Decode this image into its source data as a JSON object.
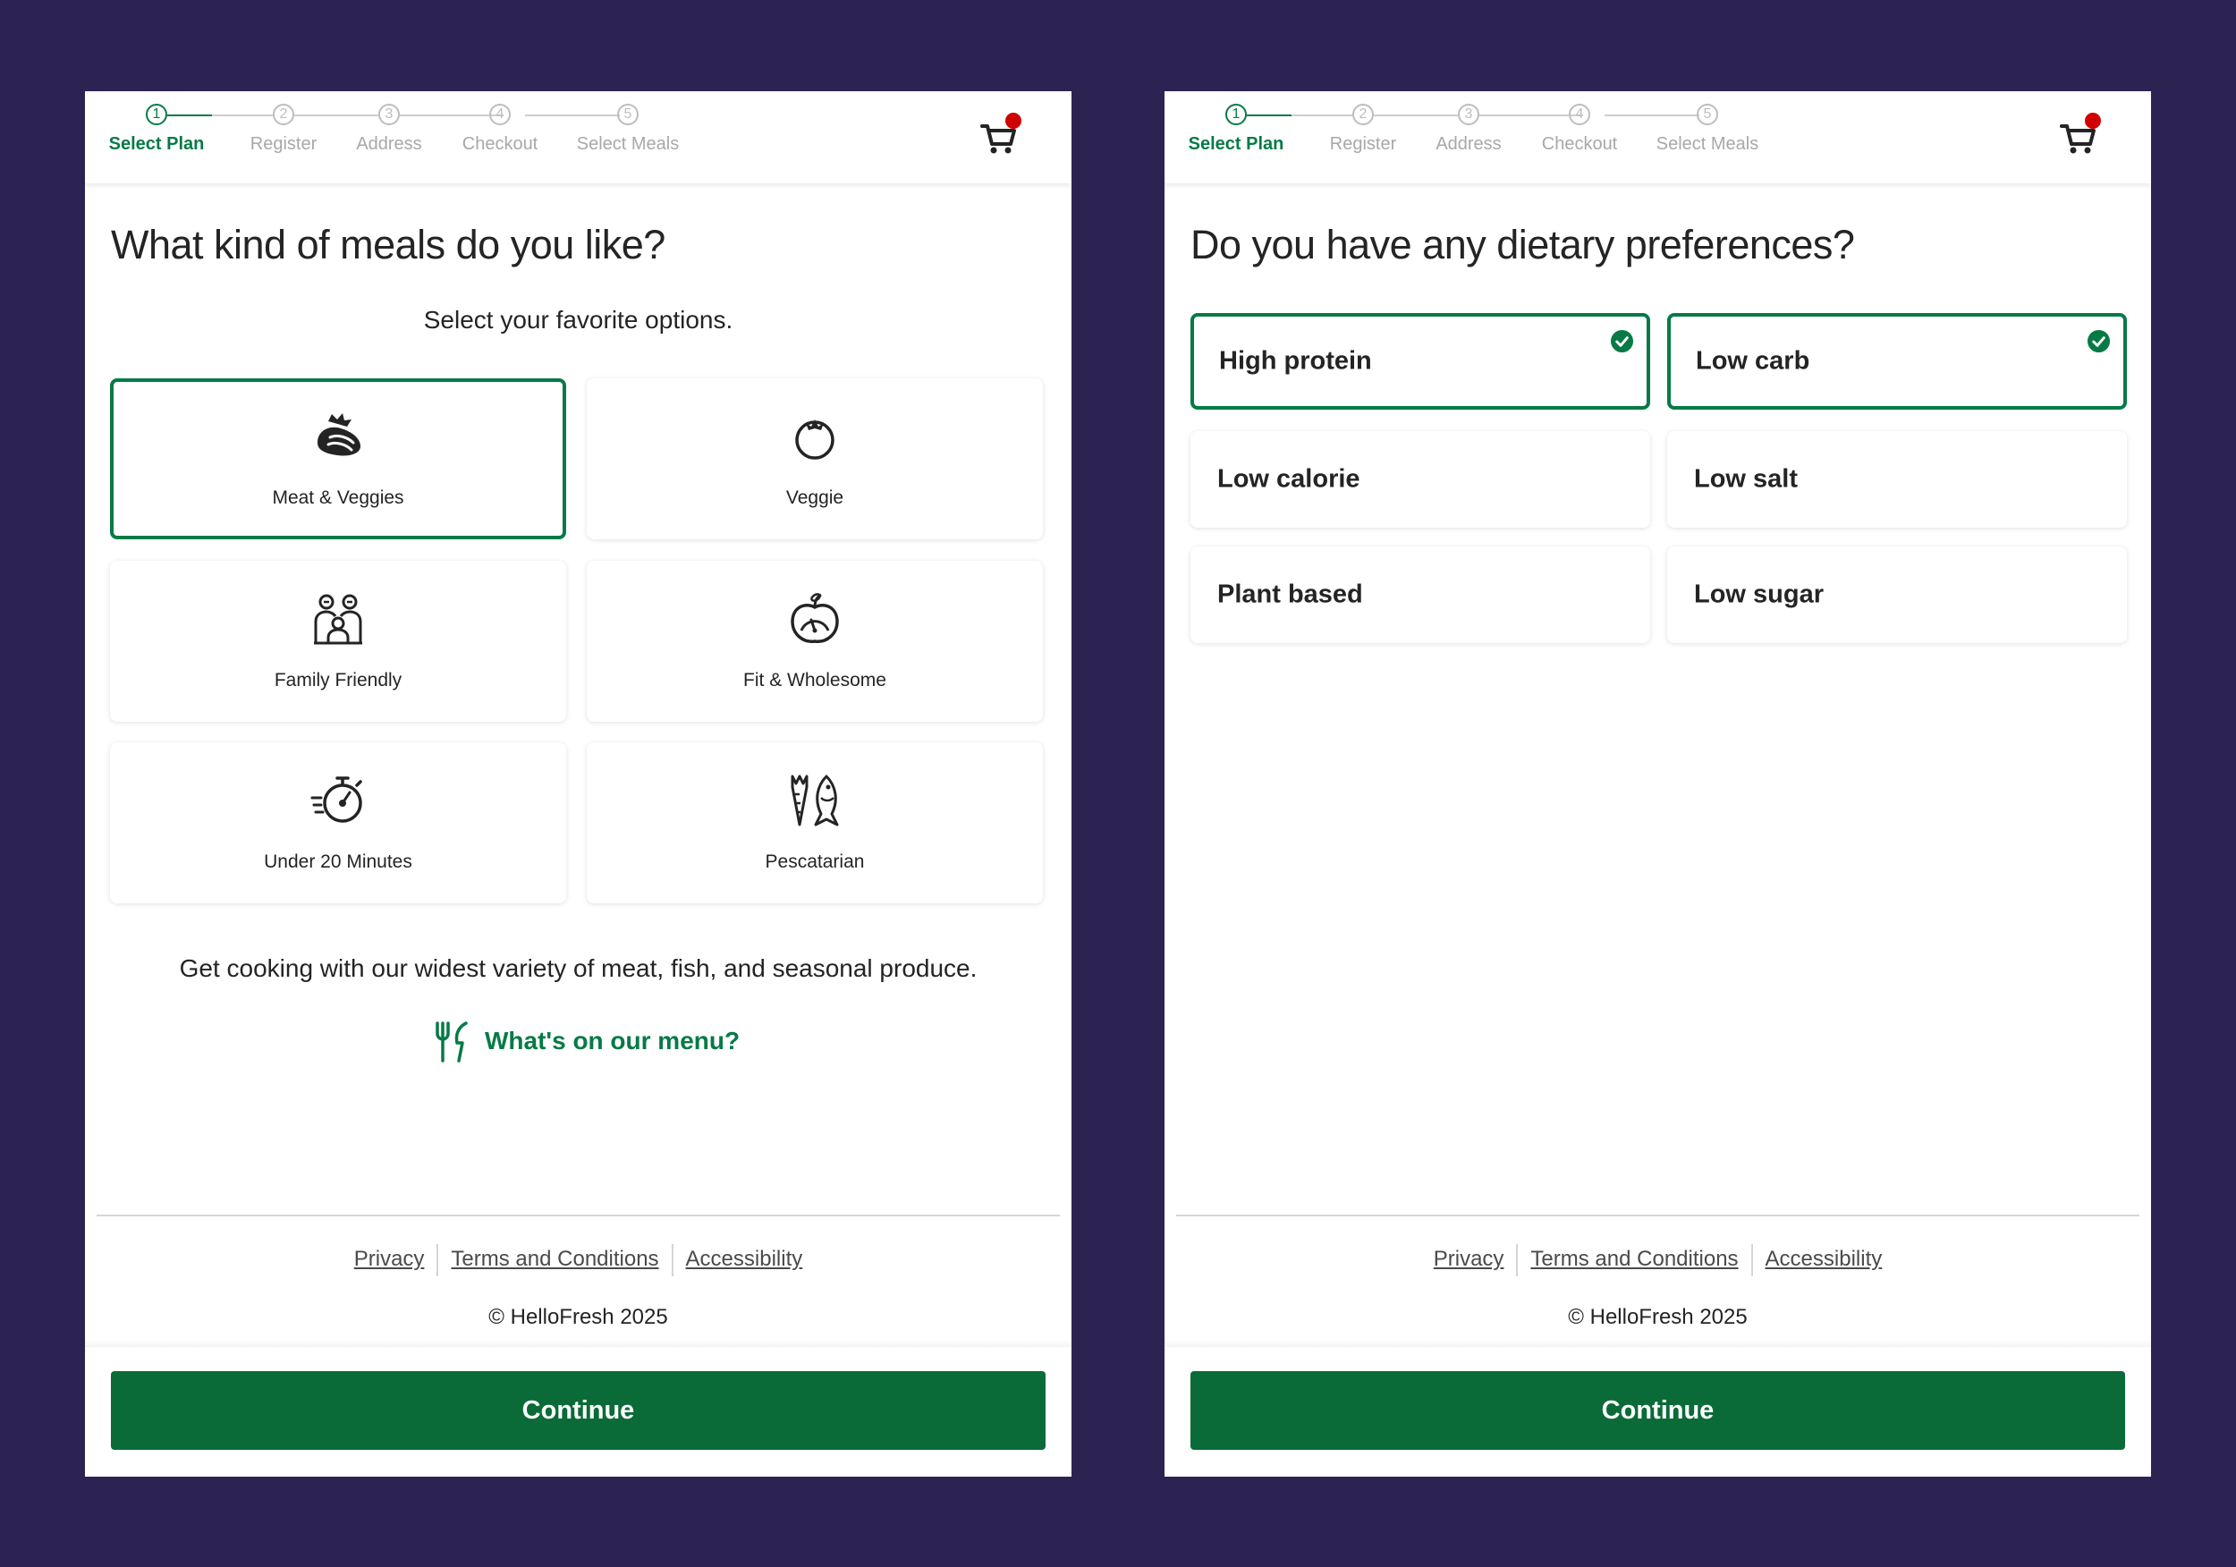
{
  "colors": {
    "background": "#2d2352",
    "brand_green": "#067a46",
    "button_green": "#0a6b38",
    "cart_badge": "#d00000"
  },
  "steps": [
    {
      "number": "1",
      "label": "Select Plan",
      "active": true
    },
    {
      "number": "2",
      "label": "Register",
      "active": false
    },
    {
      "number": "3",
      "label": "Address",
      "active": false
    },
    {
      "number": "4",
      "label": "Checkout",
      "active": false
    },
    {
      "number": "5",
      "label": "Select Meals",
      "active": false
    }
  ],
  "left": {
    "title": "What kind of meals do you like?",
    "subtitle": "Select your favorite options.",
    "options": [
      {
        "label": "Meat & Veggies",
        "icon": "meat-veggies-icon",
        "selected": true
      },
      {
        "label": "Veggie",
        "icon": "tomato-icon",
        "selected": false
      },
      {
        "label": "Family Friendly",
        "icon": "family-icon",
        "selected": false
      },
      {
        "label": "Fit & Wholesome",
        "icon": "apple-scale-icon",
        "selected": false
      },
      {
        "label": "Under 20 Minutes",
        "icon": "stopwatch-icon",
        "selected": false
      },
      {
        "label": "Pescatarian",
        "icon": "carrot-fish-icon",
        "selected": false
      }
    ],
    "description": "Get cooking with our widest variety of meat, fish, and seasonal produce.",
    "menu_link": "What's on our menu?"
  },
  "right": {
    "title": "Do you have any dietary preferences?",
    "options": [
      {
        "label": "High protein",
        "selected": true
      },
      {
        "label": "Low carb",
        "selected": true
      },
      {
        "label": "Low calorie",
        "selected": false
      },
      {
        "label": "Low salt",
        "selected": false
      },
      {
        "label": "Plant based",
        "selected": false
      },
      {
        "label": "Low sugar",
        "selected": false
      }
    ]
  },
  "footer": {
    "privacy": "Privacy",
    "terms": "Terms and Conditions",
    "accessibility": "Accessibility",
    "copyright": "© HelloFresh 2025"
  },
  "continue_label": "Continue"
}
